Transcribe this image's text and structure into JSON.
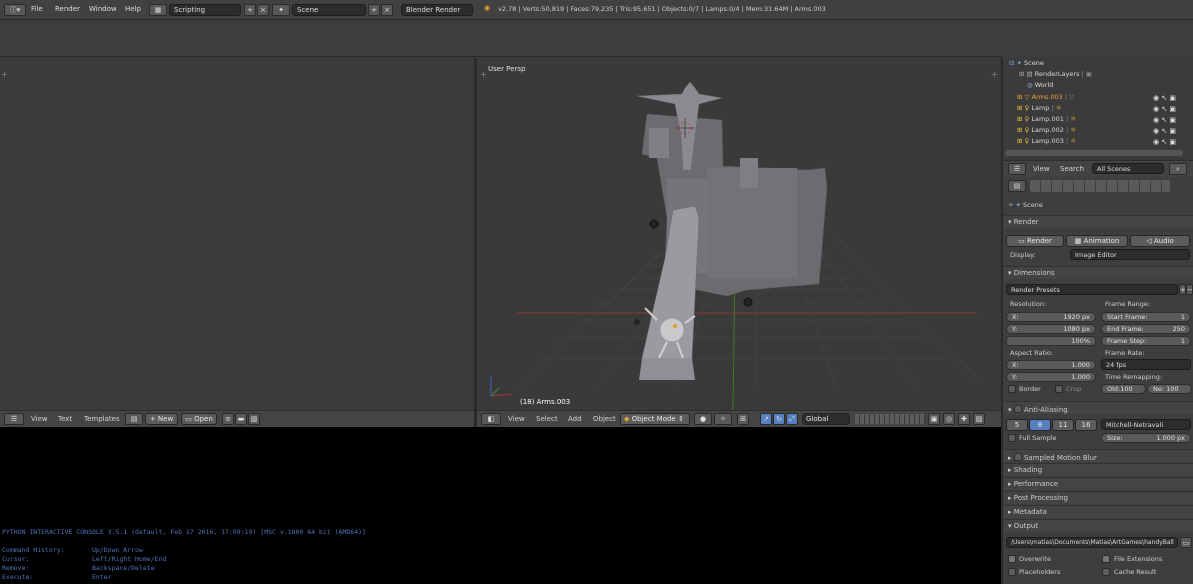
{
  "topbar": {
    "menus": [
      "File",
      "Render",
      "Window",
      "Help"
    ],
    "screen_layout": "Scripting",
    "scene": "Scene",
    "render_engine": "Blender Render",
    "info": "v2.78 | Verts:50,819 | Faces:79,235 | Tris:95,651 | Objects:0/7 | Lamps:0/4 | Mem:31.64M | Arms.003"
  },
  "text_editor": {
    "menus": [
      "View",
      "Text",
      "Templates"
    ],
    "new_label": "New",
    "open_label": "Open"
  },
  "viewport": {
    "label": "User Persp",
    "object_label": "(18) Arms.003",
    "menus": [
      "View",
      "Select",
      "Add",
      "Object"
    ],
    "mode": "Object Mode",
    "orientation": "Global"
  },
  "console": {
    "banner": "PYTHON INTERACTIVE CONSOLE 3.5.1 (default, Feb 17 2016, 17:09:19) [MSC v.1800 64 bit (AMD64)]",
    "help": [
      [
        "Command History:",
        "Up/Down Arrow"
      ],
      [
        "Cursor:",
        "Left/Right Home/End"
      ],
      [
        "Remove:",
        "Backspace/Delete"
      ],
      [
        "Execute:",
        "Enter"
      ]
    ]
  },
  "outliner": {
    "items": [
      "Scene",
      "RenderLayers",
      "World",
      "Arms.003",
      "Lamp",
      "Lamp.001",
      "Lamp.002",
      "Lamp.003"
    ],
    "menus": [
      "View",
      "Search"
    ],
    "filter": "All Scenes"
  },
  "properties": {
    "context": "Scene",
    "render": {
      "header": "Render",
      "render_btn": "Render",
      "animation_btn": "Animation",
      "audio_btn": "Audio",
      "display_label": "Display:",
      "display_value": "Image Editor"
    },
    "dimensions": {
      "header": "Dimensions",
      "presets": "Render Presets",
      "resolution_label": "Resolution:",
      "x_label": "X:",
      "x_value": "1920 px",
      "y_label": "Y:",
      "y_value": "1080 px",
      "percent": "100%",
      "frame_range_label": "Frame Range:",
      "start_label": "Start Frame:",
      "start_value": "1",
      "end_label": "End Frame:",
      "end_value": "250",
      "step_label": "Frame Step:",
      "step_value": "1",
      "aspect_label": "Aspect Ratio:",
      "ax_label": "X:",
      "ax_value": "1.000",
      "ay_label": "Y:",
      "ay_value": "1.000",
      "frame_rate_label": "Frame Rate:",
      "frame_rate_value": "24 fps",
      "time_remap_label": "Time Remapping:",
      "old_label": "Old:",
      "old_value": "100",
      "new_label": "Ne:",
      "new_value": "100",
      "border_label": "Border",
      "crop_label": "Crop"
    },
    "anti_aliasing": {
      "header": "Anti-Aliasing",
      "samples": [
        "5",
        "8",
        "11",
        "16"
      ],
      "filter": "Mitchell-Netravali",
      "full_sample_label": "Full Sample",
      "size_label": "Size:",
      "size_value": "1.000 px"
    },
    "collapsed_panels": [
      "Sampled Motion Blur",
      "Shading",
      "Performance",
      "Post Processing",
      "Metadata"
    ],
    "output": {
      "header": "Output",
      "path": "/Users\\matias\\Documents\\Matias\\ArtGames\\handyBall",
      "overwrite_label": "Overwrite",
      "file_ext_label": "File Extensions",
      "placeholders_label": "Placeholders",
      "cache_label": "Cache Result"
    }
  },
  "colors": {
    "accent": "#5680c2",
    "console_text": "#4f74b8",
    "grid": "#4a4a4a",
    "red_axis": "#a03a3a",
    "green_axis": "#4f8f2f"
  }
}
